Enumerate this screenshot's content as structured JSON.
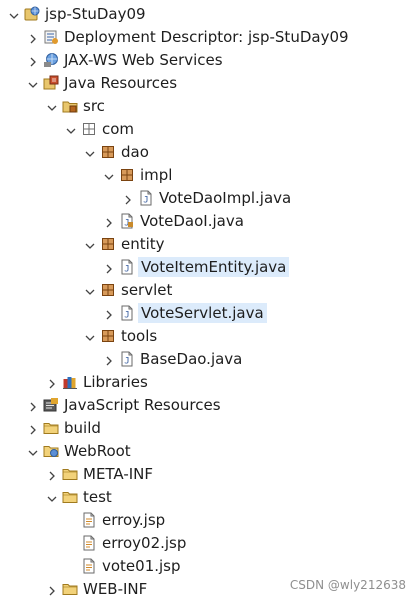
{
  "tree": {
    "items": [
      {
        "label": "jsp-StuDay09",
        "twisty": "expanded",
        "icon": "web-project-icon",
        "selected": false
      },
      {
        "label": "Deployment Descriptor: jsp-StuDay09",
        "twisty": "collapsed",
        "icon": "deployment-descriptor-icon",
        "selected": false
      },
      {
        "label": "JAX-WS Web Services",
        "twisty": "collapsed",
        "icon": "web-services-icon",
        "selected": false
      },
      {
        "label": "Java Resources",
        "twisty": "expanded",
        "icon": "java-resources-icon",
        "selected": false
      },
      {
        "label": "src",
        "twisty": "expanded",
        "icon": "source-folder-icon",
        "selected": false
      },
      {
        "label": "com",
        "twisty": "expanded",
        "icon": "empty-package-icon",
        "selected": false
      },
      {
        "label": "dao",
        "twisty": "expanded",
        "icon": "package-icon",
        "selected": false
      },
      {
        "label": "impl",
        "twisty": "expanded",
        "icon": "package-icon",
        "selected": false
      },
      {
        "label": "VoteDaoImpl.java",
        "twisty": "collapsed",
        "icon": "java-file-icon",
        "selected": false
      },
      {
        "label": "VoteDaoI.java",
        "twisty": "collapsed",
        "icon": "java-interface-file-icon",
        "selected": false
      },
      {
        "label": "entity",
        "twisty": "expanded",
        "icon": "package-icon",
        "selected": false
      },
      {
        "label": "VoteItemEntity.java",
        "twisty": "collapsed",
        "icon": "java-file-icon",
        "selected": true
      },
      {
        "label": "servlet",
        "twisty": "expanded",
        "icon": "package-icon",
        "selected": false
      },
      {
        "label": "VoteServlet.java",
        "twisty": "collapsed",
        "icon": "java-file-icon",
        "selected": true
      },
      {
        "label": "tools",
        "twisty": "expanded",
        "icon": "package-icon",
        "selected": false
      },
      {
        "label": "BaseDao.java",
        "twisty": "collapsed",
        "icon": "java-file-icon",
        "selected": false
      },
      {
        "label": "Libraries",
        "twisty": "collapsed",
        "icon": "libraries-icon",
        "selected": false
      },
      {
        "label": "JavaScript Resources",
        "twisty": "collapsed",
        "icon": "javascript-resources-icon",
        "selected": false
      },
      {
        "label": "build",
        "twisty": "collapsed",
        "icon": "folder-icon",
        "selected": false
      },
      {
        "label": "WebRoot",
        "twisty": "expanded",
        "icon": "web-folder-icon",
        "selected": false
      },
      {
        "label": "META-INF",
        "twisty": "collapsed",
        "icon": "folder-icon",
        "selected": false
      },
      {
        "label": "test",
        "twisty": "expanded",
        "icon": "folder-icon",
        "selected": false
      },
      {
        "label": "erroy.jsp",
        "twisty": "none",
        "icon": "jsp-file-icon",
        "selected": false
      },
      {
        "label": "erroy02.jsp",
        "twisty": "none",
        "icon": "jsp-file-icon",
        "selected": false
      },
      {
        "label": "vote01.jsp",
        "twisty": "none",
        "icon": "jsp-file-icon",
        "selected": false
      },
      {
        "label": "WEB-INF",
        "twisty": "collapsed",
        "icon": "folder-icon",
        "selected": false
      }
    ]
  },
  "watermark": "CSDN @wly212638",
  "colors": {
    "selection": "#dcebfb",
    "package": "#b5651d",
    "folder": "#e8c66d",
    "java": "#4a6ea8"
  }
}
